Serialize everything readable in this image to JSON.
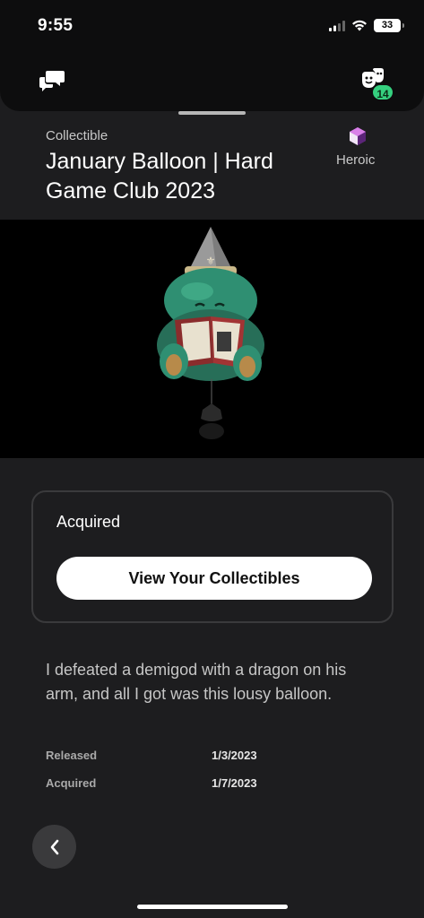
{
  "status_bar": {
    "time": "9:55",
    "battery": "33",
    "icons": [
      "signal-icon",
      "wifi-icon",
      "battery-icon"
    ]
  },
  "header": {
    "left_icon": "chat-icon",
    "right_icon": "friends-icon",
    "friends_badge": "14",
    "badge_color": "#35d07f"
  },
  "collectible": {
    "type_label": "Collectible",
    "title": "January Balloon | Hard Game Club 2023",
    "rarity": "Heroic",
    "rarity_icon": "heroic-cube-icon",
    "rarity_color": "#b54fd6",
    "image_subject": "balloon-image"
  },
  "status_card": {
    "status": "Acquired",
    "button_label": "View Your Collectibles"
  },
  "description": "I defeated a demigod with a dragon on his arm, and all I got was this lousy balloon.",
  "details": [
    {
      "label": "Released",
      "value": "1/3/2023"
    },
    {
      "label": "Acquired",
      "value": "1/7/2023"
    }
  ],
  "navigation": {
    "back_icon": "chevron-left-icon"
  }
}
